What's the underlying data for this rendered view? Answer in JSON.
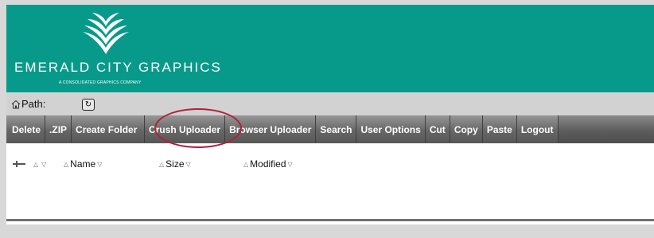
{
  "banner": {
    "brand": "EMERALD CITY GRAPHICS",
    "tagline": "A CONSOLIDATED GRAPHICS COMPANY",
    "logo_icon": "wing-logo-icon",
    "bg_color": "#079a8a"
  },
  "pathbar": {
    "label": "Path:",
    "home_icon": "home-icon",
    "refresh_icon": "refresh-icon"
  },
  "toolbar": {
    "items": [
      "Delete",
      ".ZIP",
      "Create Folder",
      "Crush Uploader",
      "Browser Uploader",
      "Search",
      "User Options",
      "Cut",
      "Copy",
      "Paste",
      "Logout"
    ]
  },
  "annotation": {
    "circled_item": "Crush Uploader",
    "color": "#b3203a"
  },
  "columns": {
    "name": "Name",
    "size": "Size",
    "modified": "Modified"
  }
}
